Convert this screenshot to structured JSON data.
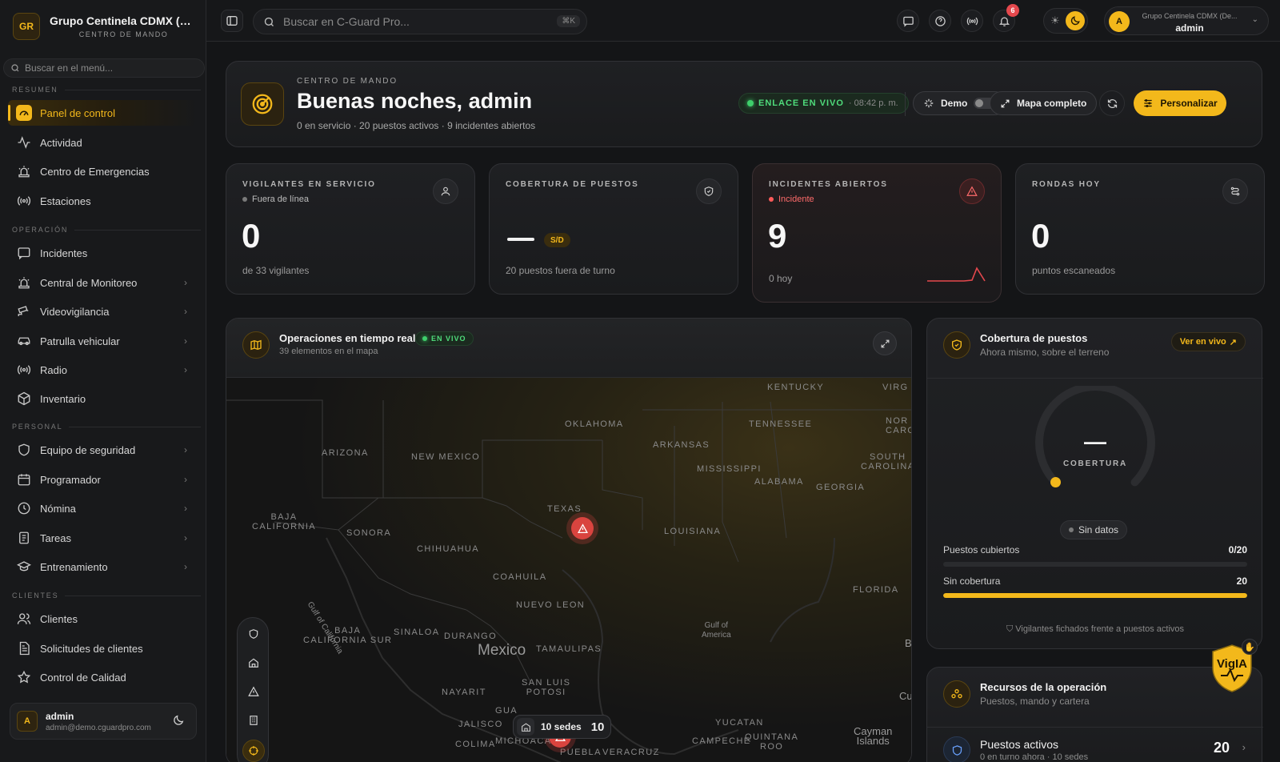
{
  "sidebar": {
    "brand": {
      "initials": "GR",
      "name": "Grupo Centinela CDMX (De...",
      "subtitle": "CENTRO DE MANDO"
    },
    "search_placeholder": "Buscar en el menú...",
    "sections": {
      "resumen": "RESUMEN",
      "operacion": "OPERACIÓN",
      "personal": "PERSONAL",
      "clientes": "CLIENTES"
    },
    "items": [
      {
        "label": "Panel de control",
        "icon": "dashboard-icon",
        "active": true
      },
      {
        "label": "Actividad",
        "icon": "activity-icon"
      },
      {
        "label": "Centro de Emergencias",
        "icon": "siren-icon"
      },
      {
        "label": "Estaciones",
        "icon": "broadcast-icon"
      },
      {
        "label": "Incidentes",
        "icon": "message-square-icon"
      },
      {
        "label": "Central de Monitoreo",
        "icon": "siren-icon",
        "chevron": true
      },
      {
        "label": "Videovigilancia",
        "icon": "cctv-icon",
        "chevron": true
      },
      {
        "label": "Patrulla vehicular",
        "icon": "car-icon",
        "chevron": true
      },
      {
        "label": "Radio",
        "icon": "radio-icon",
        "chevron": true
      },
      {
        "label": "Inventario",
        "icon": "package-icon"
      },
      {
        "label": "Equipo de seguridad",
        "icon": "shield-icon",
        "chevron": true
      },
      {
        "label": "Programador",
        "icon": "calendar-icon",
        "chevron": true
      },
      {
        "label": "Nómina",
        "icon": "clock-icon",
        "chevron": true
      },
      {
        "label": "Tareas",
        "icon": "clipboard-icon",
        "chevron": true
      },
      {
        "label": "Entrenamiento",
        "icon": "graduation-cap-icon",
        "chevron": true
      },
      {
        "label": "Clientes",
        "icon": "users-icon"
      },
      {
        "label": "Solicitudes de clientes",
        "icon": "file-text-icon"
      },
      {
        "label": "Control de Calidad",
        "icon": "star-icon"
      }
    ],
    "user": {
      "initial": "A",
      "name": "admin",
      "email": "admin@demo.cguardpro.com"
    }
  },
  "topbar": {
    "search_placeholder": "Buscar en C-Guard Pro...",
    "shortcut": "⌘K",
    "notifications_count": "6",
    "account": {
      "initial": "A",
      "org": "Grupo Centinela CDMX (De...",
      "user": "admin"
    }
  },
  "header": {
    "eyebrow": "CENTRO DE MANDO",
    "title": "Buenas noches, admin",
    "summary": "0 en servicio · 20 puestos activos · 9 incidentes abiertos",
    "live_label": "ENLACE EN VIVO",
    "live_time": "· 08:42 p. m.",
    "demo_label": "Demo",
    "map_button": "Mapa completo",
    "customize_button": "Personalizar"
  },
  "stats": {
    "guards": {
      "label": "VIGILANTES EN SERVICIO",
      "status": "Fuera de línea",
      "value": "0",
      "sub": "de 33 vigilantes"
    },
    "coverage": {
      "label": "COBERTURA DE PUESTOS",
      "value": "—",
      "badge": "S/D",
      "sub": "20 puestos fuera de turno"
    },
    "incidents": {
      "label": "INCIDENTES ABIERTOS",
      "status": "Incidente",
      "value": "9",
      "sub": "0 hoy"
    },
    "rounds": {
      "label": "RONDAS HOY",
      "value": "0",
      "sub": "puntos escaneados"
    }
  },
  "map": {
    "title": "Operaciones en tiempo real",
    "live": "EN VIVO",
    "subtitle": "39 elementos en el mapa",
    "labels": {
      "kentucky": "KENTUCKY",
      "virg": "VIRG",
      "oklahoma": "OKLAHOMA",
      "tennessee": "TENNESSEE",
      "nor_caro": "NOR\nCARO",
      "arizona": "ARIZONA",
      "new_mexico": "NEW MEXICO",
      "arkansas": "ARKANSAS",
      "south_carolina": "SOUTH\nCAROLINA",
      "mississippi": "MISSISSIPPI",
      "alabama": "ALABAMA",
      "georgia": "GEORGIA",
      "texas": "TEXAS",
      "baja_california": "BAJA\nCALIFORNIA",
      "sonora": "SONORA",
      "louisiana": "LOUISIANA",
      "chihuahua": "CHIHUAHUA",
      "coahuila": "COAHUILA",
      "florida": "FLORIDA",
      "gulf_of_california": "Gulf of California",
      "nuevo_leon": "NUEVO LEON",
      "gulf_of_america": "Gulf of\nAmerica",
      "baja_california_sur": "BAJA\nCALIFORNIA SUR",
      "sinaloa": "SINALOA",
      "durango": "DURANGO",
      "tamaulipas": "TAMAULIPAS",
      "mexico": "Mexico",
      "san_luis_potosi": "SAN LUIS\nPOTOSI",
      "nayarit": "NAYARIT",
      "gua": "GUA",
      "jalisco": "JALISCO",
      "yucatan": "YUCATAN",
      "campeche": "CAMPECHE",
      "quintana_roo": "QUINTANA\nROO",
      "cayman_islands": "Cayman\nIslands",
      "colima": "COLIMA",
      "michoaca": "MICHOACA",
      "puebla": "PUEBLA",
      "veracruz": "VERACRUZ",
      "ba": "Ba",
      "cu": "Cu"
    },
    "sedes_label": "10 sedes",
    "sedes_count": "10"
  },
  "coverage_panel": {
    "title": "Cobertura de puestos",
    "subtitle": "Ahora mismo, sobre el terreno",
    "live_link": "Ver en vivo",
    "gauge_value": "—",
    "gauge_label": "COBERTURA",
    "gauge_fraction": 0,
    "status": "Sin datos",
    "covered_label": "Puestos cubiertos",
    "covered_value": "0/20",
    "covered_fraction": 0,
    "uncovered_label": "Sin cobertura",
    "uncovered_value": "20",
    "uncovered_fraction": 1,
    "footer": "Vigilantes fichados frente a puestos activos"
  },
  "resources": {
    "title": "Recursos de la operación",
    "subtitle": "Puestos, mando y cartera",
    "row_title": "Puestos activos",
    "row_sub": "0 en turno ahora · 10 sedes",
    "row_value": "20"
  },
  "assistant": {
    "name": "VigIA"
  },
  "colors": {
    "accent": "#f3b81b",
    "live": "#3ecf6b",
    "danger": "#e5484d",
    "info": "#6aa2ff"
  }
}
